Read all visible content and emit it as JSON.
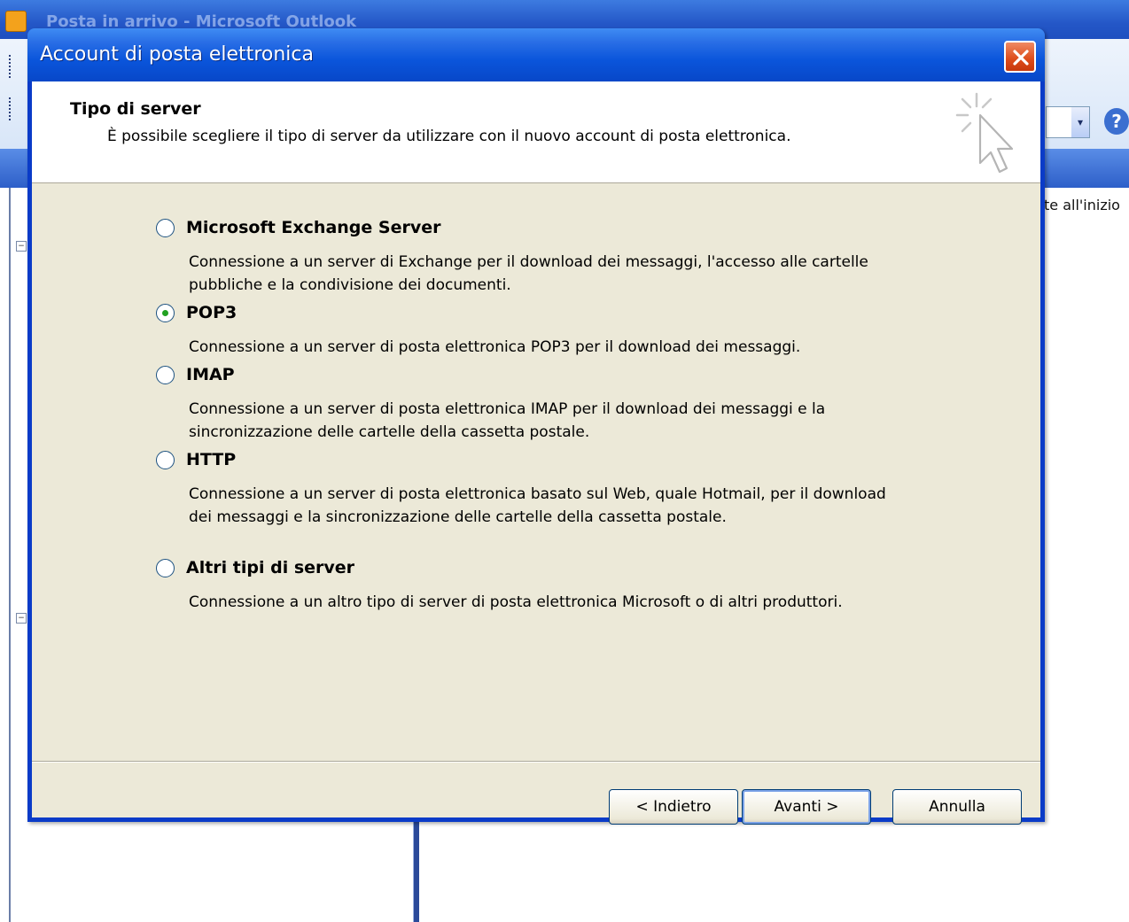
{
  "background_window": {
    "title": "Posta in arrivo - Microsoft Outlook",
    "right_pane_text": "te all'inizio",
    "help_glyph": "?",
    "dropdown_glyph": "▾"
  },
  "dialog": {
    "title": "Account di posta elettronica",
    "close_icon": "close-icon",
    "header": {
      "title": "Tipo di server",
      "subtitle": "È possibile scegliere il tipo di server da utilizzare con il nuovo account di posta elettronica."
    },
    "options": [
      {
        "label": "Microsoft Exchange Server",
        "description": "Connessione a un server di Exchange per il download dei messaggi, l'accesso alle cartelle pubbliche e la condivisione dei documenti.",
        "checked": false
      },
      {
        "label": "POP3",
        "description": "Connessione a un server di posta elettronica POP3 per il download dei messaggi.",
        "checked": true
      },
      {
        "label": "IMAP",
        "description": "Connessione a un server di posta elettronica IMAP per il download dei messaggi e la sincronizzazione delle cartelle della cassetta postale.",
        "checked": false
      },
      {
        "label": "HTTP",
        "description": "Connessione a un server di posta elettronica basato sul Web, quale Hotmail, per il download dei messaggi e la sincronizzazione delle cartelle della cassetta postale.",
        "checked": false
      },
      {
        "label": "Altri tipi di server",
        "description": "Connessione a un altro tipo di server di posta elettronica Microsoft o di altri produttori.",
        "checked": false
      }
    ],
    "buttons": {
      "back": "< Indietro",
      "next": "Avanti >",
      "cancel": "Annulla"
    }
  },
  "colors": {
    "titlebar_blue": "#0a55db",
    "dialog_face": "#ece9d8",
    "radio_checked": "#21a121",
    "close_red": "#dd4b1a"
  }
}
